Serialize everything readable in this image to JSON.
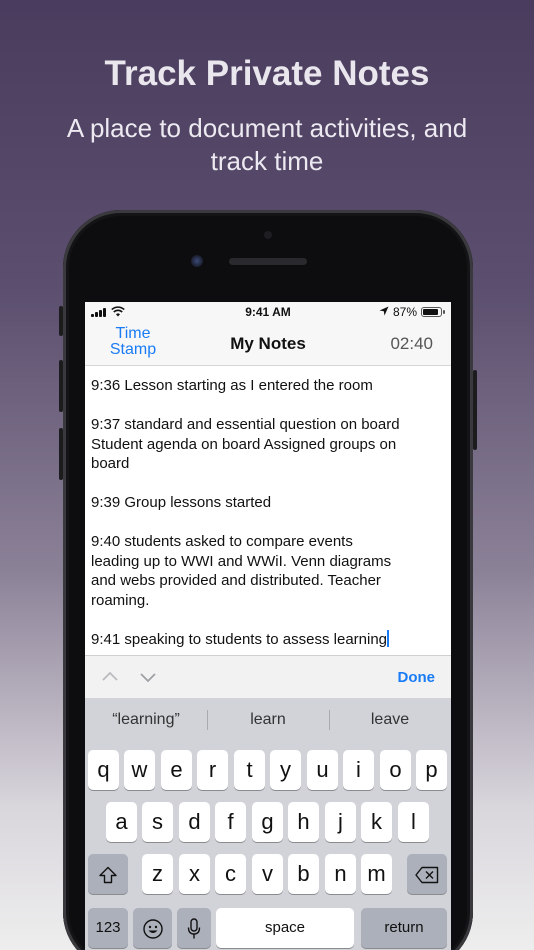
{
  "promo": {
    "title": "Track Private Notes",
    "subtitle": "A place to document activities, and track time"
  },
  "status_bar": {
    "time": "9:41 AM",
    "battery": "87%"
  },
  "nav": {
    "left_label": "Time Stamp",
    "title": "My Notes",
    "timer": "02:40"
  },
  "notes": [
    "9:36 Lesson starting as I entered the room",
    "",
    "9:37 standard and essential question on board",
    "Student agenda on board Assigned groups on",
    "board",
    "",
    "9:39 Group lessons started",
    "",
    "9:40 students asked to compare events",
    "leading up to WWI and WWiI. Venn diagrams",
    "and webs provided and distributed. Teacher",
    "roaming.",
    "",
    "9:41 speaking to students to assess learning"
  ],
  "accessory": {
    "done_label": "Done"
  },
  "keyboard": {
    "suggestions": [
      "“learning”",
      "learn",
      "leave"
    ],
    "row1": [
      "q",
      "w",
      "e",
      "r",
      "t",
      "y",
      "u",
      "i",
      "o",
      "p"
    ],
    "row2": [
      "a",
      "s",
      "d",
      "f",
      "g",
      "h",
      "j",
      "k",
      "l"
    ],
    "row3": [
      "z",
      "x",
      "c",
      "v",
      "b",
      "n",
      "m"
    ],
    "numbers_label": "123",
    "space_label": "space",
    "return_label": "return"
  },
  "colors": {
    "accent": "#1a7cf5",
    "background_top": "#4a3c5d"
  }
}
